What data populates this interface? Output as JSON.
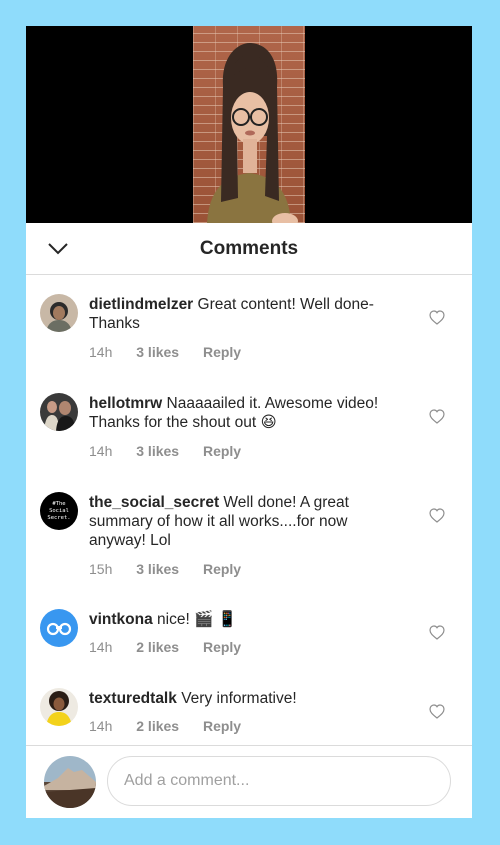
{
  "header": {
    "title": "Comments"
  },
  "comments": [
    {
      "username": "dietlindmelzer",
      "text": "Great content! Well done- Thanks",
      "time": "14h",
      "likes": "3 likes",
      "reply": "Reply"
    },
    {
      "username": "hellotmrw",
      "text": "Naaaaailed it. Awesome video! Thanks for the shout out 😆",
      "time": "14h",
      "likes": "3 likes",
      "reply": "Reply"
    },
    {
      "username": "the_social_secret",
      "text": "Well done!  A great summary of how it all works....for now anyway! Lol",
      "time": "15h",
      "likes": "3 likes",
      "reply": "Reply",
      "avatar_text": "#The Social Secret."
    },
    {
      "username": "vintkona",
      "text": "nice! 🎬 📱",
      "time": "14h",
      "likes": "2 likes",
      "reply": "Reply"
    },
    {
      "username": "texturedtalk",
      "text": "Very informative!",
      "time": "14h",
      "likes": "2 likes",
      "reply": "Reply"
    }
  ],
  "composer": {
    "placeholder": "Add a comment..."
  },
  "icons": {
    "collapse": "chevron-down-icon",
    "like": "heart-icon"
  },
  "colors": {
    "page_background": "#8fdcfb",
    "vintkona_avatar": "#3897f0"
  }
}
